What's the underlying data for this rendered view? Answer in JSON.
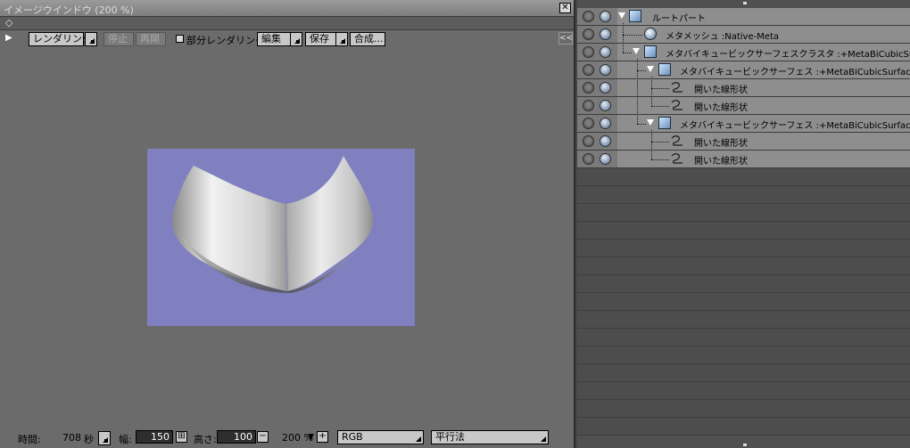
{
  "window": {
    "title": "イメージウインドウ (200 %)",
    "close": "✕",
    "expand_glyph": "◇"
  },
  "toolbar": {
    "play": "▶",
    "render": "レンダリング",
    "stop": "停止",
    "redo": "再開",
    "partial_render": "部分レンダリング",
    "edit": "編集",
    "save": "保存",
    "compose": "合成...",
    "collapse": "<<"
  },
  "status": {
    "time_label": "時間:",
    "time_value": "708",
    "seconds_label": "秒",
    "width_label": "幅:",
    "width_value": "150",
    "height_label": "高さ:",
    "height_value": "100",
    "zoom_minus": "−",
    "zoom_value": "200 %",
    "zoom_plus": "+",
    "zoom_arrow": "▼",
    "link_icon_glyph": "⊞",
    "color_mode": "RGB",
    "projection": "平行法"
  },
  "render": {
    "background": "#8080c0",
    "object_color": "#d8d8d8"
  },
  "hierarchy": {
    "items": [
      {
        "label": "ルートパート",
        "icon": "root-part-icon"
      },
      {
        "label": "メタメッシュ :Native-Meta",
        "icon": "meta-mesh-icon"
      },
      {
        "label": "メタバイキュービックサーフェスクラスタ :+MetaBiCubicSurface",
        "icon": "surface-cluster-icon"
      },
      {
        "label": "メタバイキュービックサーフェス :+MetaBiCubicSurface",
        "icon": "surface-icon"
      },
      {
        "label": "開いた線形状",
        "icon": "open-curve-icon"
      },
      {
        "label": "開いた線形状",
        "icon": "open-curve-icon"
      },
      {
        "label": "メタバイキュービックサーフェス :+MetaBiCubicSurface",
        "icon": "surface-icon"
      },
      {
        "label": "開いた線形状",
        "icon": "open-curve-icon"
      },
      {
        "label": "開いた線形状",
        "icon": "open-curve-icon"
      }
    ]
  }
}
